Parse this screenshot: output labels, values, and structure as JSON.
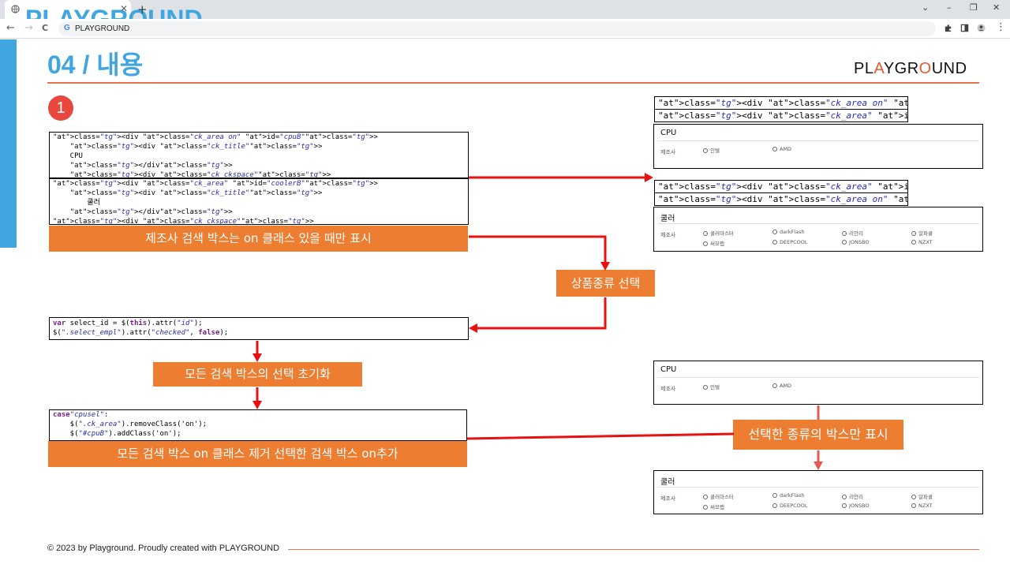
{
  "browser": {
    "tab_title": "PLAYGROUND",
    "tab_close": "✕",
    "new_tab": "+",
    "address": "PLAYGROUND",
    "address_icon": "G",
    "win_chevron": "⌄",
    "win_minimize": "–",
    "win_restore": "❐",
    "win_close": "✕",
    "back": "←",
    "forward": "→",
    "reload": "C",
    "menu": "⋮"
  },
  "slide": {
    "title": "04 / 내용",
    "brand_pre": "PL",
    "brand_a": "A",
    "brand_mid": "YGR",
    "brand_o": "O",
    "brand_post": "UND",
    "step_number": "1",
    "code_block_1": [
      "<div class=\"ck_area on\" id=\"cpuB\">",
      "    <div class=\"ck_title\">",
      "    CPU",
      "    </div>",
      "    <div class=\"ck_ckspace\">"
    ],
    "code_block_2": [
      "<div class=\"ck_area\" id=\"coolerB\">",
      "    <div class=\"ck_title\">",
      "        쿨러",
      "    </div>",
      "<div class=\"ck_ckspace\">"
    ],
    "caption_onclass": "제조사 검색 박스는 on 클래스 있을 때만 표시",
    "caption_select": "상품종류 선택",
    "code_block_3": [
      "var select_id = $(this).attr(\"id\");",
      "$(\".select_empl\").attr(\"checked\", false);"
    ],
    "caption_reset": "모든 검색 박스의 선택 초기화",
    "code_block_4": [
      "case\"cpusel\":",
      "    $(\".ck_area\").removeClass('on');",
      "    $(\"#cpuB\").addClass('on');"
    ],
    "caption_toggle": "모든 검색 박스 on 클래스 제거 선택한 검색 박스 on추가",
    "caption_show": "선택한 종류의 박스만 표시",
    "tag_top_1": "<div class=\"ck_area on\" id=\"cpuB\">",
    "tag_top_2": "<div class=\"ck_area\" id=\"coolerB\">",
    "tag_mid_1": "<div class=\"ck_area\" id=\"cpuB\">",
    "tag_mid_2": "<div class=\"ck_area on\" id=\"coolerB\">",
    "panel_cpu": {
      "title": "CPU",
      "label": "제조사",
      "options": [
        "인텔",
        "AMD"
      ]
    },
    "panel_cooler": {
      "title": "쿨러",
      "label": "제조사",
      "options_row1": [
        "쿨러마스터",
        "darkFlash",
        "리안리",
        "알파쿨"
      ],
      "options_row2": [
        "써모랩",
        "DEEPCOOL",
        "JONSBO",
        "NZXT"
      ]
    },
    "footer": "© 2023 by Playground. Proudly created with PLAYGROUND"
  },
  "colors": {
    "accent_blue": "#3fa6e0",
    "accent_orange": "#ed7d31",
    "arrow_red": "#e81010"
  }
}
